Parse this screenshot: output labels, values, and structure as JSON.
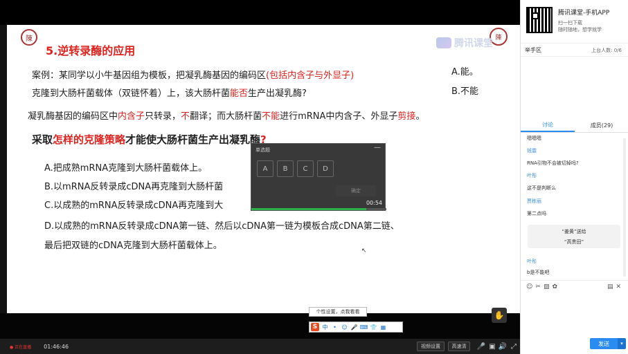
{
  "slide": {
    "title": "5.逆转录酶的应用",
    "case_prefix": "案例：某同学以小牛基因组为模板，把凝乳酶基因的编码区",
    "case_red": "(包括内含子与外显子)",
    "case_line2_a": "克隆到大肠杆菌载体（双链怀着）上，该大肠杆菌",
    "case_line2_red": "能否",
    "case_line2_b": "生产出凝乳酶?",
    "answer_a": "A.能。",
    "answer_b": "B.不能",
    "explain_a": "凝乳酶基因的编码区中",
    "explain_red1": "内含子",
    "explain_b": "只转录，",
    "explain_red2": "不",
    "explain_c": "翻译；而大肠杆菌",
    "explain_red3": "不能",
    "explain_d": "进行mRNA中内含子、外显子",
    "explain_red4": "剪接",
    "explain_e": "。",
    "question_a": "采取",
    "question_red": "怎样的克隆策略",
    "question_b": "才能使大肠杆菌生产出凝乳酶",
    "question_mark": "?",
    "option_a": "A.把成熟mRNA克隆到大肠杆菌载体上。",
    "option_b": "B.以mRNA反转录成cDNA再克隆到大肠杆菌",
    "option_c": "C.以成熟的mRNA反转录成cDNA再克隆到大",
    "option_d1": "D.以成熟的mRNA反转录成cDNA第一链、然后以cDNA第一链为模板合成cDNA第二链、",
    "option_d2": "最后把双链的cDNA克隆到大肠杆菌载体上。",
    "watermark": "腾讯课堂",
    "logo_left": "陳",
    "logo_right": "陳"
  },
  "quiz": {
    "title": "单选题",
    "min": "—",
    "options": [
      "A",
      "B",
      "C",
      "D"
    ],
    "confirm": "确定",
    "timer": "00:54",
    "progress_percent": 85
  },
  "ime": {
    "tip": "个性设置，点我看看",
    "s": "S",
    "glyphs": [
      "中",
      "•",
      "☺",
      "🎤",
      "⌨",
      "👕",
      "▦"
    ]
  },
  "controls": {
    "live_label": "● 正在直播",
    "time": "01:46:46",
    "video_settings": "视频设置",
    "chosen": "高速清",
    "mic": "🎤",
    "cam": "▣",
    "volume": "🔊",
    "fullscreen": "⤢"
  },
  "panel": {
    "app_title": "腾讯课堂-手机APP",
    "app_sub1": "扫一扫下载",
    "app_sub2": "随时随地，想学就学",
    "hand_label": "举手区",
    "hand_count": "上台人数: 0/6",
    "tab_discuss": "讨论",
    "tab_members": "成员(29)",
    "messages": [
      {
        "name": "",
        "text": "嗯嗯嗯"
      },
      {
        "name": "钱震",
        "text": "RNA引物不会被切掉吗?"
      },
      {
        "name": "叶彤",
        "text": "这不是判断么"
      },
      {
        "name": "贾栋丽",
        "text": "第二点吗"
      },
      {
        "name": "叶彤",
        "text": "b是不能吧"
      }
    ],
    "gift_line1": "“姜黄”送给",
    "gift_line2": "“高贵田”",
    "send": "发送",
    "send_arrow": "▾"
  }
}
